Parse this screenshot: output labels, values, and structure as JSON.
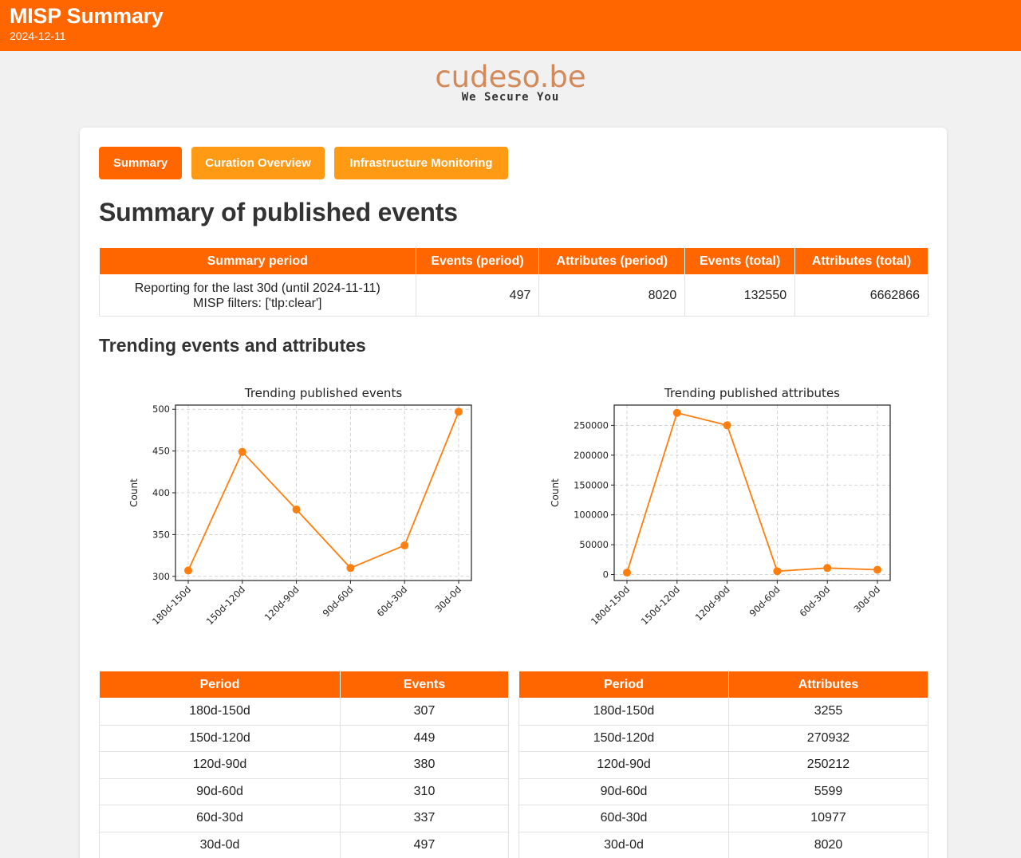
{
  "header": {
    "title": "MISP Summary",
    "date": "2024-12-11"
  },
  "brand": {
    "name": "cudeso.be",
    "tagline": "We Secure You"
  },
  "tabs": [
    {
      "label": "Summary",
      "active": true
    },
    {
      "label": "Curation Overview",
      "active": false
    },
    {
      "label": "Infrastructure Monitoring",
      "active": false
    }
  ],
  "page_title": "Summary of published events",
  "summary_table": {
    "headers": [
      "Summary period",
      "Events (period)",
      "Attributes (period)",
      "Events (total)",
      "Attributes (total)"
    ],
    "row": {
      "period_line1": "Reporting for the last 30d (until 2024-11-11)",
      "period_line2": "MISP filters: ['tlp:clear']",
      "events_period": "497",
      "attributes_period": "8020",
      "events_total": "132550",
      "attributes_total": "6662866"
    }
  },
  "trending_title": "Trending events and attributes",
  "events_table": {
    "headers": [
      "Period",
      "Events"
    ],
    "rows": [
      [
        "180d-150d",
        "307"
      ],
      [
        "150d-120d",
        "449"
      ],
      [
        "120d-90d",
        "380"
      ],
      [
        "90d-60d",
        "310"
      ],
      [
        "60d-30d",
        "337"
      ],
      [
        "30d-0d",
        "497"
      ]
    ]
  },
  "attributes_table": {
    "headers": [
      "Period",
      "Attributes"
    ],
    "rows": [
      [
        "180d-150d",
        "3255"
      ],
      [
        "150d-120d",
        "270932"
      ],
      [
        "120d-90d",
        "250212"
      ],
      [
        "90d-60d",
        "5599"
      ],
      [
        "60d-30d",
        "10977"
      ],
      [
        "30d-0d",
        "8020"
      ]
    ]
  },
  "colors": {
    "accent": "#ff6600",
    "tab_inactive": "#ff9a14",
    "brand_text": "#d28a5a",
    "line": "#ff7f0e"
  },
  "chart_data": [
    {
      "type": "line",
      "title": "Trending published events",
      "xlabel": "",
      "ylabel": "Count",
      "categories": [
        "180d-150d",
        "150d-120d",
        "120d-90d",
        "90d-60d",
        "60d-30d",
        "30d-0d"
      ],
      "values": [
        307,
        449,
        380,
        310,
        337,
        497
      ],
      "ylim": [
        295,
        505
      ],
      "yticks": [
        300,
        350,
        400,
        450,
        500
      ],
      "grid": true
    },
    {
      "type": "line",
      "title": "Trending published attributes",
      "xlabel": "",
      "ylabel": "Count",
      "categories": [
        "180d-150d",
        "150d-120d",
        "120d-90d",
        "90d-60d",
        "60d-30d",
        "30d-0d"
      ],
      "values": [
        3255,
        270932,
        250212,
        5599,
        10977,
        8020
      ],
      "ylim": [
        -10000,
        284000
      ],
      "yticks": [
        0,
        50000,
        100000,
        150000,
        200000,
        250000
      ],
      "grid": true
    }
  ]
}
